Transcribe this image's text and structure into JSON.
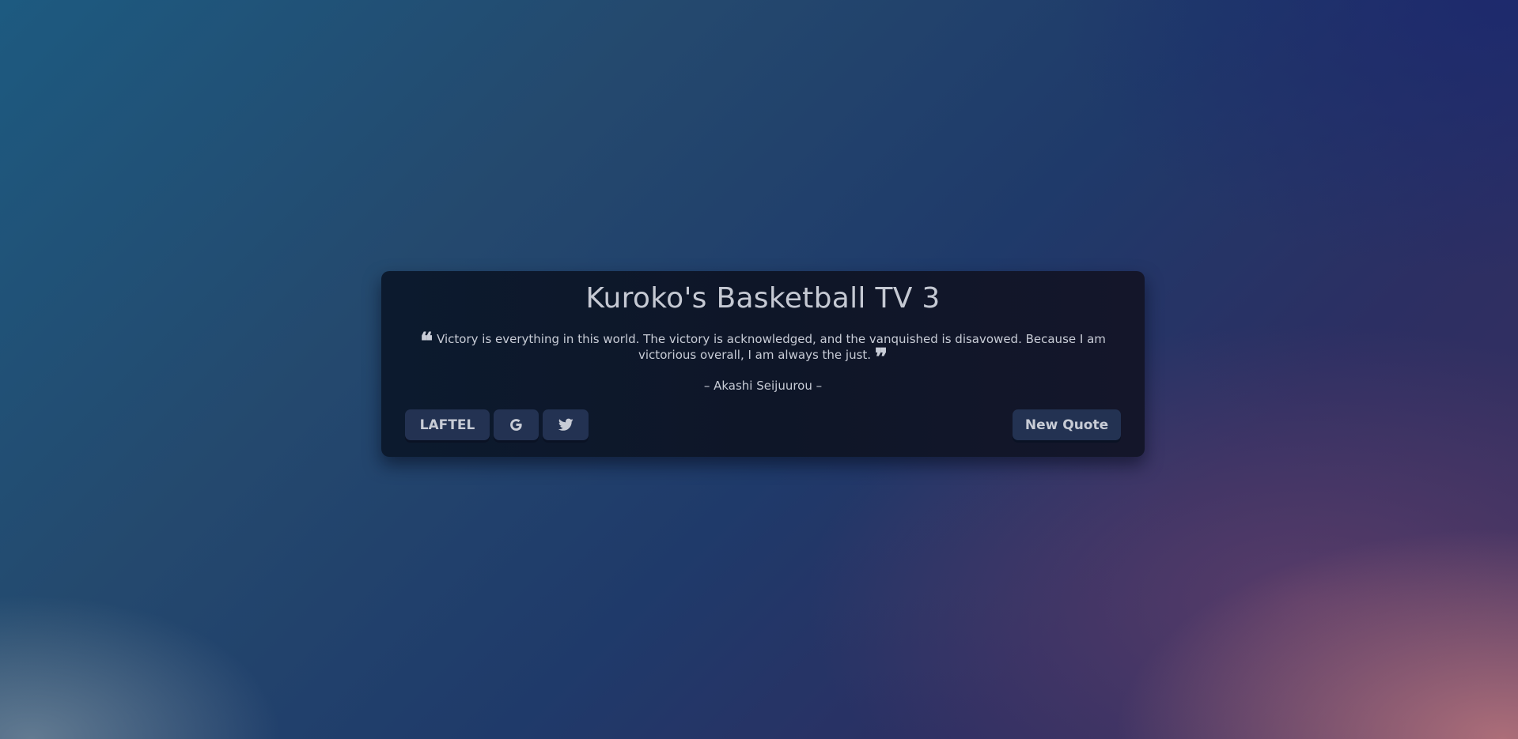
{
  "card": {
    "title": "Kuroko's Basketball TV 3",
    "quote": "Victory is everything in this world. The victory is acknowledged, and the vanquished is disavowed. Because I am victorious overall, I am always the just.",
    "open_quote_glyph": "❝",
    "close_quote_glyph": "❞",
    "author": "– Akashi Seijuurou –"
  },
  "buttons": {
    "laftel_label": "LAFTEL",
    "google_icon": "google-icon",
    "twitter_icon": "twitter-icon",
    "new_quote_label": "New Quote"
  },
  "colors": {
    "card_bg": "#0e1628",
    "button_bg": "#233252",
    "text": "#c8ccd6"
  }
}
